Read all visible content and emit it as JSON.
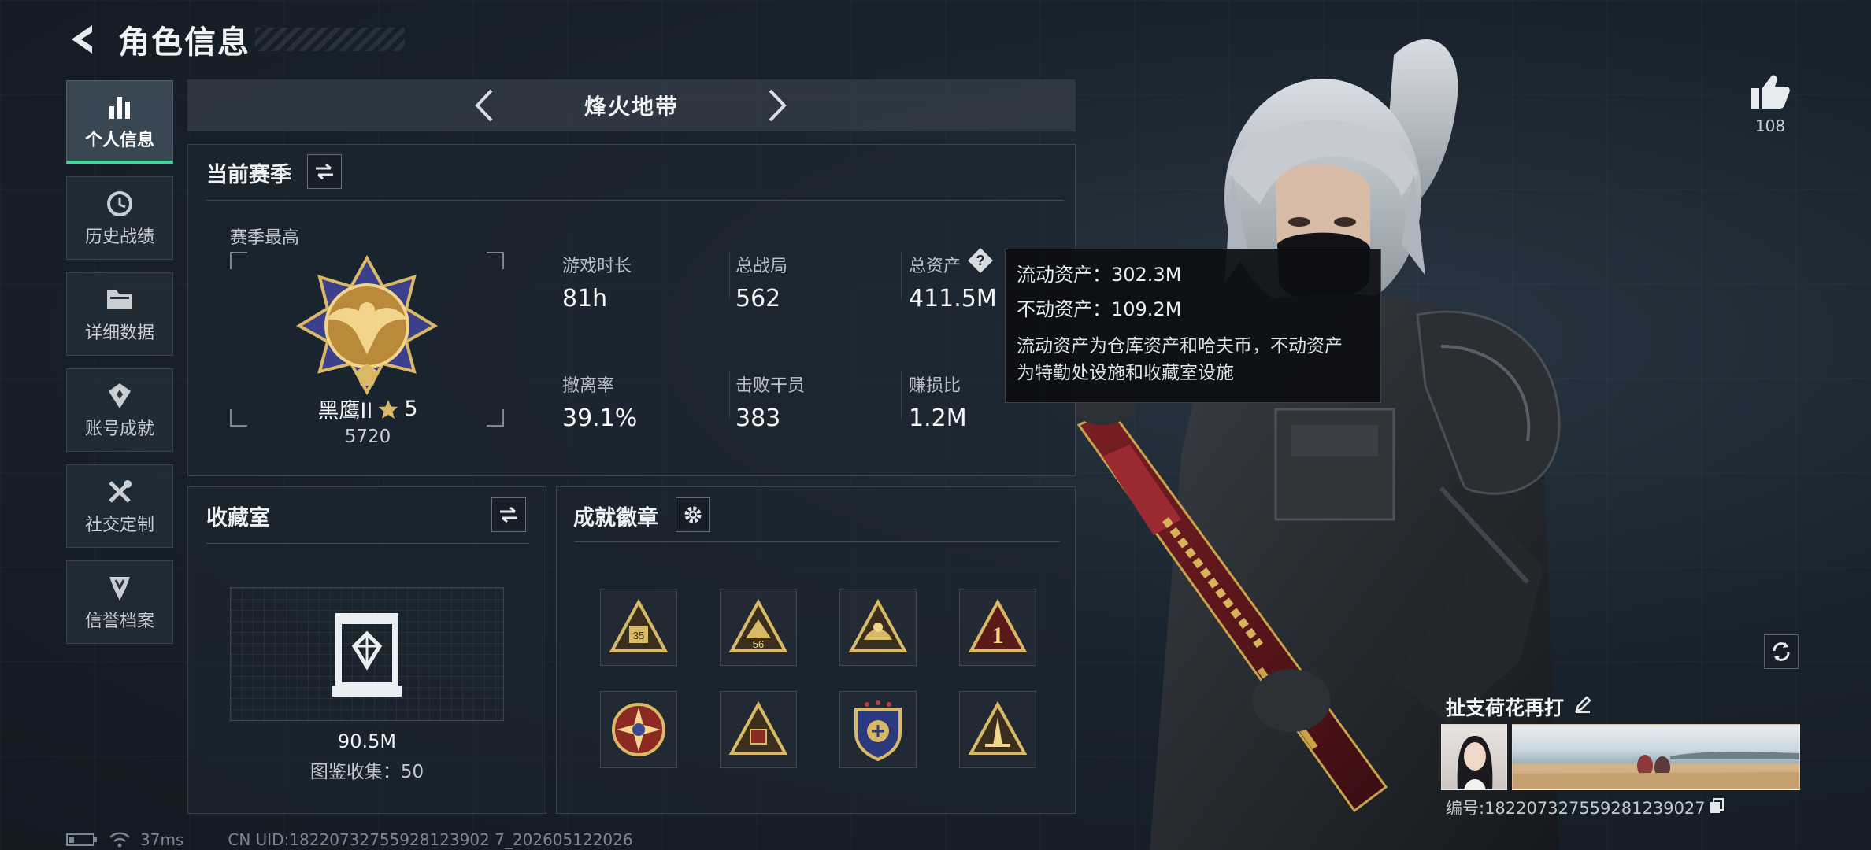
{
  "header": {
    "title": "角色信息"
  },
  "sidebar": {
    "items": [
      {
        "label": "个人信息",
        "icon": "bar-chart-icon"
      },
      {
        "label": "历史战绩",
        "icon": "history-clock-icon"
      },
      {
        "label": "详细数据",
        "icon": "folder-icon"
      },
      {
        "label": "账号成就",
        "icon": "medal-icon"
      },
      {
        "label": "社交定制",
        "icon": "tools-icon"
      },
      {
        "label": "信誉档案",
        "icon": "credibility-icon"
      }
    ]
  },
  "mode": {
    "title": "烽火地带"
  },
  "season": {
    "title": "当前赛季",
    "best_label": "赛季最高",
    "rank_name": "黑鹰II",
    "rank_stars": "5",
    "rank_score": "5720",
    "stats": [
      {
        "label": "游戏时长",
        "value": "81h"
      },
      {
        "label": "总战局",
        "value": "562"
      },
      {
        "label": "总资产",
        "value": "411.5M"
      },
      {
        "label": "撤离率",
        "value": "39.1%"
      },
      {
        "label": "击败干员",
        "value": "383"
      },
      {
        "label": "赚损比",
        "value": "1.2M"
      }
    ]
  },
  "tooltip": {
    "liquid": "流动资产：302.3M",
    "fixed": "不动资产：109.2M",
    "desc_line1": "流动资产为仓库资产和哈夫币，不动资产",
    "desc_line2": "为特勤处设施和收藏室设施"
  },
  "collection": {
    "title": "收藏室",
    "value": "90.5M",
    "catalog": "图鉴收集：50"
  },
  "badges": {
    "title": "成就徽章",
    "items": [
      {
        "icon": "badge-icon-1",
        "text": "35"
      },
      {
        "icon": "badge-icon-2",
        "text": "56"
      },
      {
        "icon": "badge-icon-3",
        "text": ""
      },
      {
        "icon": "badge-icon-4",
        "text": "1"
      },
      {
        "icon": "badge-icon-5",
        "text": ""
      },
      {
        "icon": "badge-icon-6",
        "text": ""
      },
      {
        "icon": "badge-icon-7",
        "text": ""
      },
      {
        "icon": "badge-icon-8",
        "text": ""
      }
    ]
  },
  "status": {
    "ping": "37ms",
    "uid": "CN UID:18220732755928123902 7_202605122026"
  },
  "player": {
    "likes": "108",
    "name": "扯支荷花再打",
    "id": "编号:182207327559281239027"
  },
  "colors": {
    "accent": "#3fd89a",
    "gold": "#c9a34a",
    "tooltip_bg": "#0c0e12"
  }
}
